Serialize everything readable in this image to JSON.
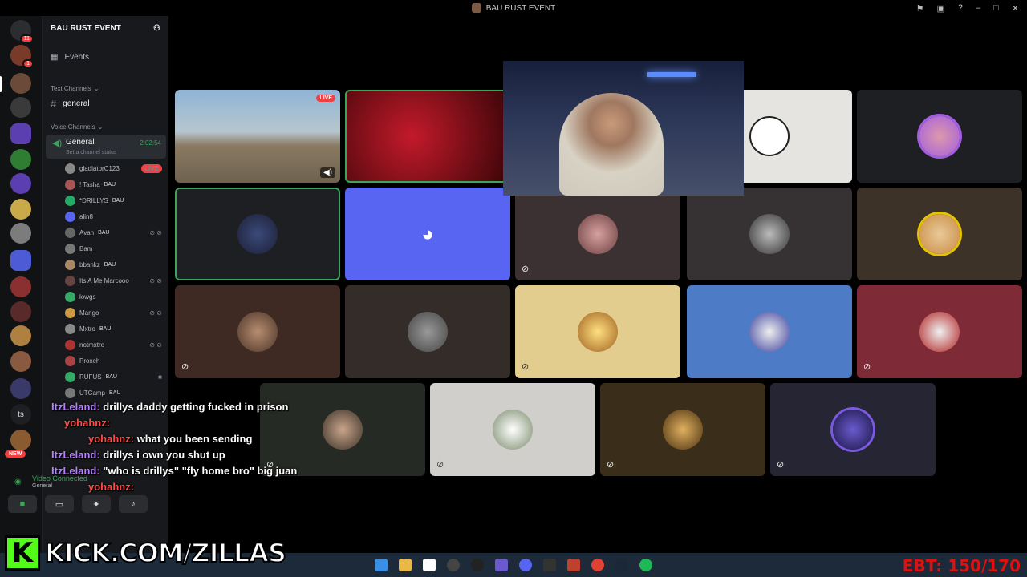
{
  "window": {
    "title": "BAU RUST EVENT"
  },
  "server": {
    "name": "BAU RUST EVENT"
  },
  "sidebar": {
    "events_label": "Events",
    "text_category": "Text Channels",
    "general_text": "general",
    "voice_category": "Voice Channels",
    "voice_channel": "General",
    "voice_timer": "2:02:54",
    "channel_status": "Set a channel status",
    "badges": {
      "home": "11",
      "second": "1"
    }
  },
  "voice_users": [
    {
      "name": "gladiatorC123",
      "tag": "",
      "live": "LIVE"
    },
    {
      "name": "! Tasha",
      "tag": "BAU"
    },
    {
      "name": "*DRILLYS",
      "tag": "BAU"
    },
    {
      "name": "alin8",
      "tag": ""
    },
    {
      "name": "Avan",
      "tag": "BAU"
    },
    {
      "name": "Bam",
      "tag": ""
    },
    {
      "name": "bbankz",
      "tag": "BAU"
    },
    {
      "name": "Its A Me Marcooo",
      "tag": ""
    },
    {
      "name": "lowgs",
      "tag": ""
    },
    {
      "name": "Mango",
      "tag": ""
    },
    {
      "name": "Mxtro",
      "tag": "BAU"
    },
    {
      "name": "notmxtro",
      "tag": ""
    },
    {
      "name": "Proxeh",
      "tag": ""
    },
    {
      "name": "RUFUS",
      "tag": "BAU"
    },
    {
      "name": "UTCamp",
      "tag": "BAU"
    }
  ],
  "server_list_labels": {
    "ts": "ts",
    "new": "NEW"
  },
  "voice_status": {
    "label": "Video Connected",
    "sub": "General"
  },
  "stage": {
    "live_badge": "LIVE"
  },
  "chat": [
    {
      "user": "ItzLeland:",
      "text": "drillys daddy getting fucked in prison"
    },
    {
      "user": "yohahnz:",
      "text": ""
    },
    {
      "user": "yohahnz:",
      "text": "what you been sending"
    },
    {
      "user": "ItzLeland:",
      "text": "drillys i own you shut up"
    },
    {
      "user": "ItzLeland:",
      "text": "\"who is drillys\" \"fly home bro\" big juan"
    },
    {
      "user": "yohahnz:",
      "text": ""
    }
  ],
  "overlay": {
    "kick_logo": "K",
    "kick_url": "KICK.COM/ZILLAS",
    "ebt": "EBT: 150/170"
  },
  "colors": {
    "blurple": "#5865f2",
    "speaking": "#3ba55c",
    "live": "#ed4245",
    "kick": "#53fc18"
  }
}
